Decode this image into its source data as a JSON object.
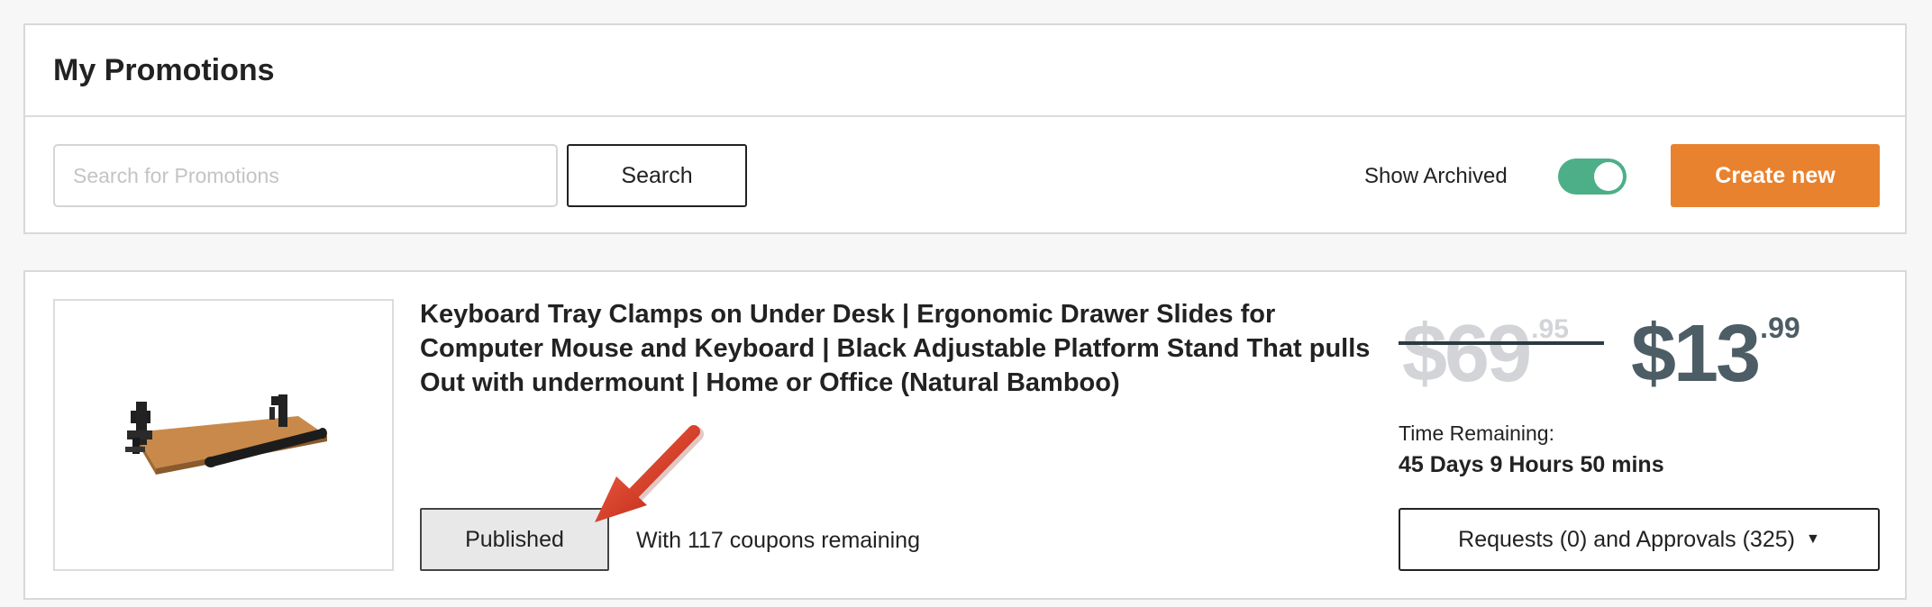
{
  "header": {
    "title": "My Promotions"
  },
  "toolbar": {
    "search_placeholder": "Search for Promotions",
    "search_value": "",
    "search_label": "Search",
    "show_archived_label": "Show Archived",
    "show_archived_on": true,
    "create_label": "Create new"
  },
  "promotion": {
    "title": "Keyboard Tray Clamps on Under Desk | Ergonomic Drawer Slides for Computer Mouse and Keyboard | Black Adjustable Platform Stand That pulls Out with undermount | Home or Office (Natural Bamboo)",
    "status": "Published",
    "coupons_text": "With 117 coupons remaining",
    "old_price_dollars": "$69",
    "old_price_cents": ".95",
    "new_price_dollars": "$13",
    "new_price_cents": ".99",
    "time_label": "Time Remaining:",
    "time_value": "45 Days 9 Hours 50 mins",
    "requests_label": "Requests (0) and Approvals (325)"
  },
  "icons": {
    "caret": "caret-down-icon",
    "annotation": "red-arrow-icon"
  },
  "colors": {
    "accent": "#e8822f",
    "toggle_on": "#4caf87",
    "old_price": "#d2d4d8",
    "new_price": "#4d5d66",
    "annotation_arrow": "#d8402b"
  }
}
